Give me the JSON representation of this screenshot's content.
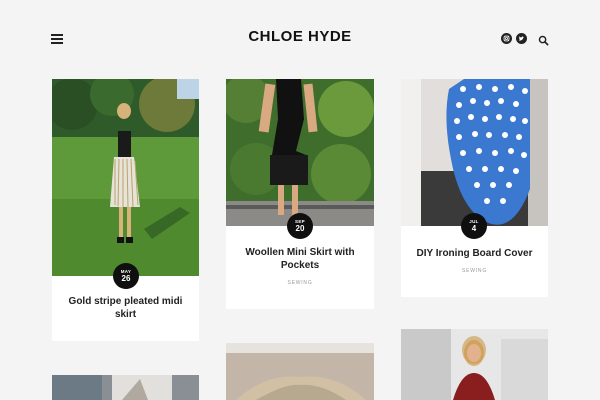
{
  "header": {
    "site_title": "CHLOE HYDE",
    "menu_icon": "hamburger-menu-icon",
    "social_icons": [
      "instagram-icon",
      "twitter-icon"
    ],
    "search_icon": "search-icon"
  },
  "posts": [
    {
      "title": "Gold stripe pleated midi skirt",
      "month": "MAY",
      "day": "26",
      "category": ""
    },
    {
      "title": "Woollen Mini Skirt with Pockets",
      "month": "SEP",
      "day": "20",
      "category": "SEWING"
    },
    {
      "title": "DIY Ironing Board Cover",
      "month": "JUL",
      "day": "4",
      "category": "SEWING"
    }
  ],
  "colors": {
    "background": "#f4f4f4",
    "card": "#ffffff",
    "badge": "#0f0f0f",
    "text": "#222222",
    "category": "#999999"
  }
}
